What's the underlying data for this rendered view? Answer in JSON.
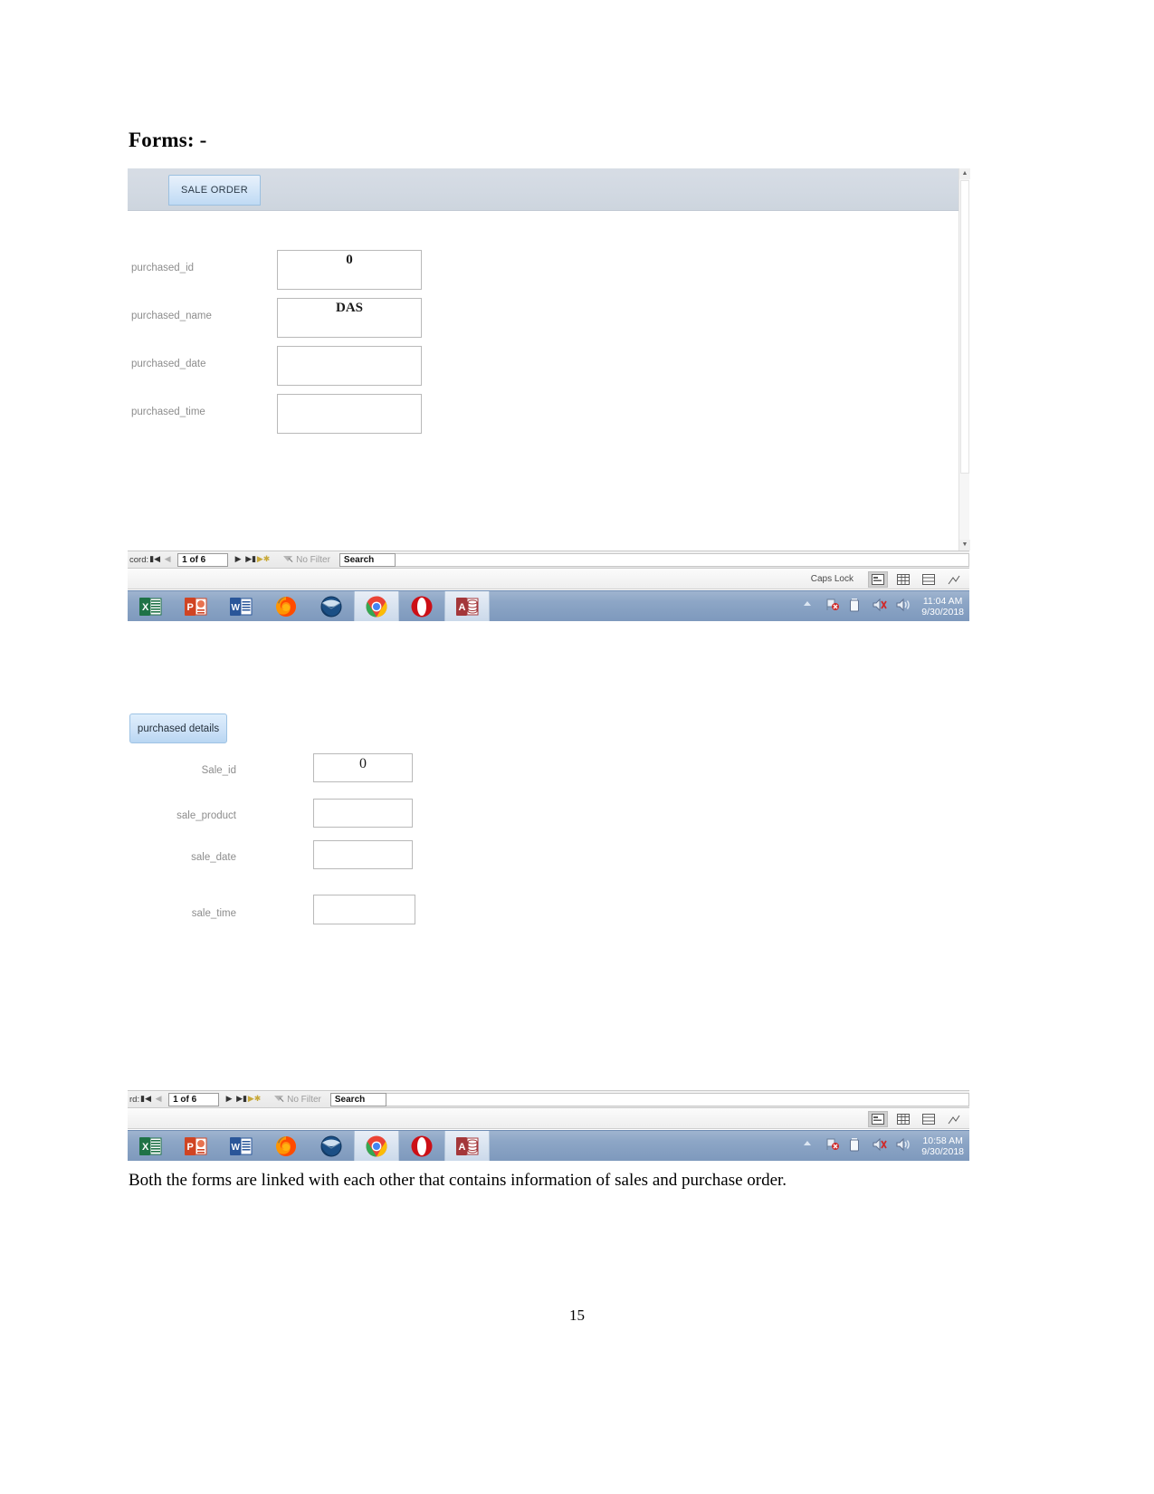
{
  "document": {
    "heading": "Forms: -",
    "caption": "Both the forms are linked with each other that contains information of sales and purchase order.",
    "page_number": "15"
  },
  "screenshot1": {
    "app": "Microsoft Access",
    "tab_label": "SALE ORDER",
    "fields": [
      {
        "label": "purchased_id",
        "value": "0"
      },
      {
        "label": "purchased_name",
        "value": "DAS"
      },
      {
        "label": "purchased_date",
        "value": ""
      },
      {
        "label": "purchased_time",
        "value": ""
      }
    ],
    "navbar": {
      "record_label": "cord:",
      "first_icon": "first-record-icon",
      "prev_icon": "previous-record-icon",
      "record_value": "1 of 6",
      "next_icon": "next-record-icon",
      "last_icon": "last-record-icon",
      "new_icon": "new-record-icon",
      "filter_label": "No Filter",
      "filter_icon": "filter-funnel-icon",
      "search_value": "Search"
    },
    "statusbar": {
      "caps_lock": "Caps Lock",
      "views": [
        "form-view-icon",
        "datasheet-view-icon",
        "layout-view-icon",
        "design-view-icon"
      ]
    },
    "taskbar": {
      "apps": [
        {
          "name": "excel",
          "letter": "X",
          "color": "#1f7246"
        },
        {
          "name": "powerpoint",
          "letter": "P",
          "color": "#d04423"
        },
        {
          "name": "word",
          "letter": "W",
          "color": "#2a5699"
        },
        {
          "name": "firefox",
          "letter": "",
          "color": "#e8661b"
        },
        {
          "name": "thunderbird",
          "letter": "",
          "color": "#1f5b8f"
        },
        {
          "name": "chrome",
          "letter": "",
          "color": "#4285f4"
        },
        {
          "name": "opera",
          "letter": "O",
          "color": "#cc0f16"
        },
        {
          "name": "access",
          "letter": "A",
          "color": "#a4373a"
        }
      ],
      "tray": [
        "show-hidden-icons",
        "network-error-icon",
        "battery-icon",
        "volume-muted-icon",
        "volume-icon"
      ],
      "time": "11:04 AM",
      "date": "9/30/2018"
    }
  },
  "screenshot2": {
    "tab_label": "purchased details",
    "fields": [
      {
        "label": "Sale_id",
        "value": "0"
      },
      {
        "label": "sale_product",
        "value": ""
      },
      {
        "label": "sale_date",
        "value": ""
      },
      {
        "label": "sale_time",
        "value": ""
      }
    ],
    "navbar": {
      "record_label": "rd:",
      "record_value": "1 of 6",
      "filter_label": "No Filter",
      "search_value": "Search"
    },
    "statusbar": {
      "views": [
        "form-view-icon",
        "datasheet-view-icon",
        "layout-view-icon",
        "design-view-icon"
      ]
    },
    "taskbar": {
      "time": "10:58 AM",
      "date": "9/30/2018"
    }
  }
}
